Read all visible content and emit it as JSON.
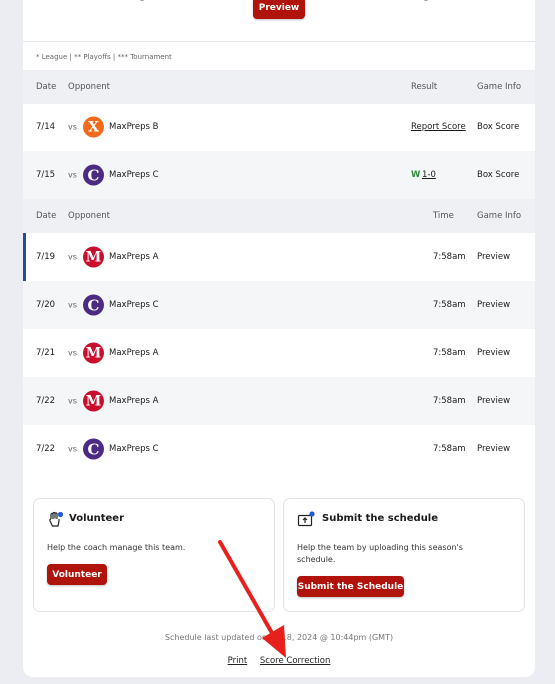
{
  "top": {
    "preview_label": "Preview"
  },
  "legend": "* League | ** Playoffs | *** Tournament",
  "results": {
    "headers": {
      "date": "Date",
      "opponent": "Opponent",
      "result": "Result",
      "info": "Game Info"
    },
    "rows": [
      {
        "date": "7/14",
        "vs": "vs",
        "logo": "X",
        "opponent": "MaxPreps B",
        "result": "Report Score",
        "info": "Box Score"
      },
      {
        "date": "7/15",
        "vs": "vs",
        "logo": "C",
        "opponent": "MaxPreps C",
        "result_wl": "W",
        "result": "1-0",
        "info": "Box Score"
      }
    ]
  },
  "upcoming": {
    "headers": {
      "date": "Date",
      "opponent": "Opponent",
      "time": "Time",
      "info": "Game Info"
    },
    "rows": [
      {
        "date": "7/19",
        "vs": "vs",
        "logo": "M",
        "opponent": "MaxPreps A",
        "time": "7:58am",
        "info": "Preview"
      },
      {
        "date": "7/20",
        "vs": "vs",
        "logo": "C",
        "opponent": "MaxPreps C",
        "time": "7:58am",
        "info": "Preview"
      },
      {
        "date": "7/21",
        "vs": "vs",
        "logo": "M",
        "opponent": "MaxPreps A",
        "time": "7:58am",
        "info": "Preview"
      },
      {
        "date": "7/22",
        "vs": "vs",
        "logo": "M",
        "opponent": "MaxPreps A",
        "time": "7:58am",
        "info": "Preview"
      },
      {
        "date": "7/22",
        "vs": "vs",
        "logo": "C",
        "opponent": "MaxPreps C",
        "time": "7:58am",
        "info": "Preview"
      }
    ]
  },
  "volunteer": {
    "title": "Volunteer",
    "desc": "Help the coach manage this team.",
    "button": "Volunteer",
    "icon": "hand-icon"
  },
  "submit": {
    "title": "Submit the schedule",
    "desc_line1": "Help the team by uploading this season's",
    "desc_line2": "schedule.",
    "button": "Submit the Schedule",
    "icon": "upload-icon"
  },
  "footer": {
    "updated": "Schedule last updated on Jul 18, 2024 @ 10:44pm (GMT)",
    "print": "Print",
    "correction": "Score Correction"
  },
  "colors": {
    "accent": "#b0130b",
    "active_bar": "#1d4f9c",
    "win": "#2e8b3a",
    "annotation": "#e8201c"
  }
}
